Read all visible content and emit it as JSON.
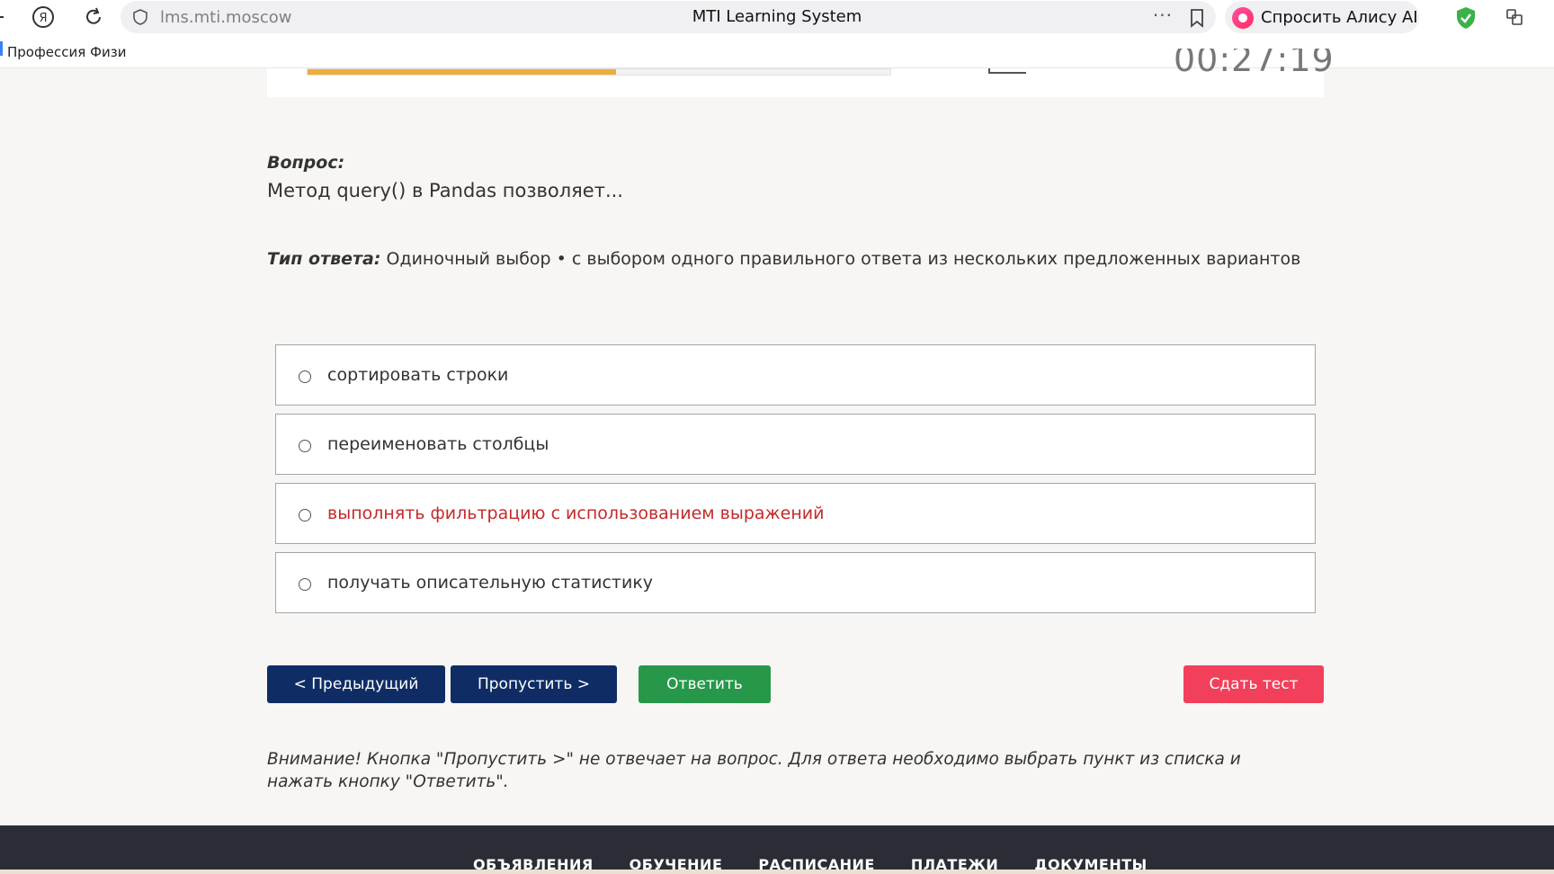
{
  "browser": {
    "url": "lms.mti.moscow",
    "title": "MTI Learning System",
    "alice_label": "Спросить Алису AI",
    "bookmark": "Профессия Физи"
  },
  "test": {
    "progress": 0.53,
    "timer": "00:27:19"
  },
  "question": {
    "label": "Вопрос:",
    "text": "Метод query() в Pandas позволяет...",
    "answer_type_label": "Тип ответа:",
    "answer_type_value": "Одиночный выбор • с выбором одного правильного ответа из нескольких предложенных вариантов"
  },
  "options": [
    {
      "label": "сортировать строки",
      "highlighted": false
    },
    {
      "label": "переименовать столбцы",
      "highlighted": false
    },
    {
      "label": "выполнять фильтрацию с использованием выражений",
      "highlighted": true
    },
    {
      "label": "получать описательную статистику",
      "highlighted": false
    }
  ],
  "buttons": {
    "prev": "< Предыдущий",
    "skip": "Пропустить >",
    "answer": "Ответить",
    "submit": "Сдать тест"
  },
  "notice": "Внимание! Кнопка \"Пропустить >\" не отвечает на вопрос. Для ответа необходимо выбрать пункт из списка и нажать кнопку \"Ответить\".",
  "footer": {
    "links": [
      "ОБЪЯВЛЕНИЯ",
      "ОБУЧЕНИЕ",
      "РАСПИСАНИЕ",
      "ПЛАТЕЖИ",
      "ДОКУМЕНТЫ"
    ]
  },
  "colors": {
    "primary": "#0f2d64",
    "answer": "#27984a",
    "submit": "#f2405a",
    "progress": "#f0ad3c",
    "highlight_text": "#c52a2a"
  }
}
